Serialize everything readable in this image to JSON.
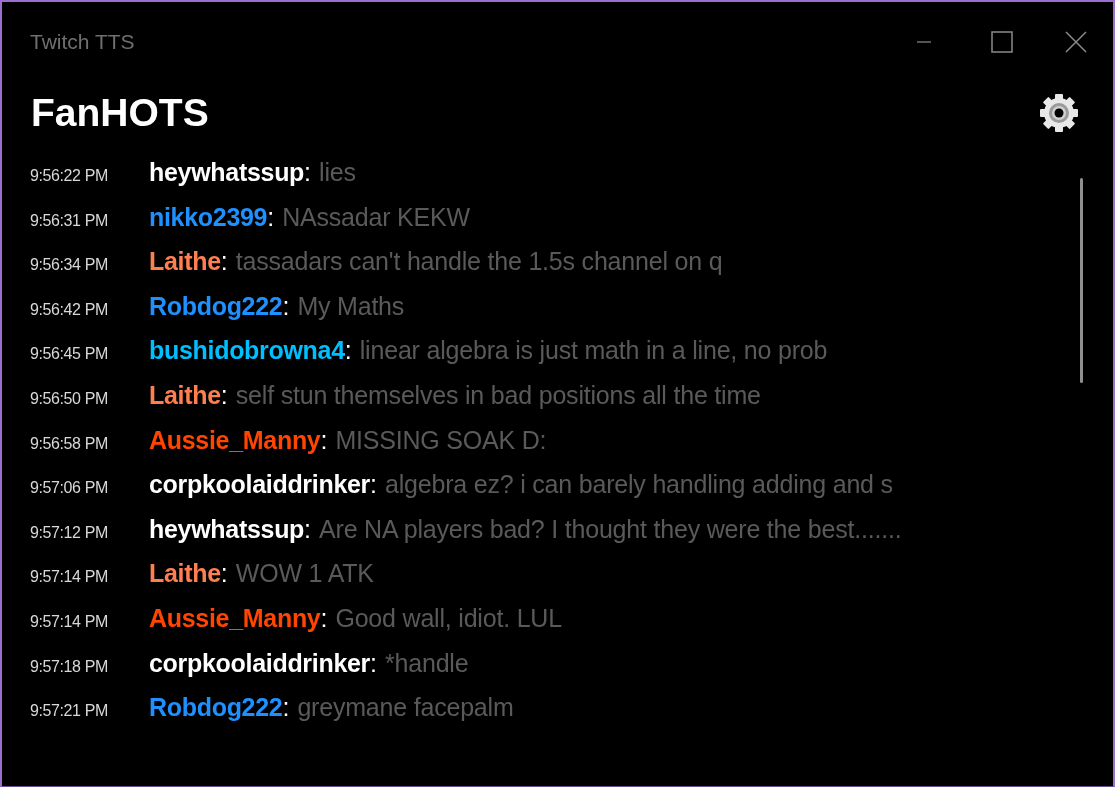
{
  "window": {
    "title": "Twitch TTS"
  },
  "header": {
    "title": "FanHOTS"
  },
  "messages": [
    {
      "time": "9:56:22 PM",
      "user": "heywhatssup",
      "color": "#ffffff",
      "text": "lies"
    },
    {
      "time": "9:56:31 PM",
      "user": "nikko2399",
      "color": "#1e90ff",
      "text": "NAssadar KEKW"
    },
    {
      "time": "9:56:34 PM",
      "user": "Laithe",
      "color": "#ff7f50",
      "text": "tassadars can't handle the 1.5s channel on q"
    },
    {
      "time": "9:56:42 PM",
      "user": "Robdog222",
      "color": "#1e90ff",
      "text": "My Maths"
    },
    {
      "time": "9:56:45 PM",
      "user": "bushidobrowna4",
      "color": "#00bfff",
      "text": "linear algebra is just math in a line, no prob"
    },
    {
      "time": "9:56:50 PM",
      "user": "Laithe",
      "color": "#ff7f50",
      "text": "self stun themselves in bad positions all the time"
    },
    {
      "time": "9:56:58 PM",
      "user": "Aussie_Manny",
      "color": "#ff4500",
      "text": "MISSING SOAK D:"
    },
    {
      "time": "9:57:06 PM",
      "user": "corpkoolaiddrinker",
      "color": "#ffffff",
      "text": "algebra ez? i can barely handling adding and s"
    },
    {
      "time": "9:57:12 PM",
      "user": "heywhatssup",
      "color": "#ffffff",
      "text": "Are NA players bad? I thought they were the best......."
    },
    {
      "time": "9:57:14 PM",
      "user": "Laithe",
      "color": "#ff7f50",
      "text": "WOW 1 ATK"
    },
    {
      "time": "9:57:14 PM",
      "user": "Aussie_Manny",
      "color": "#ff4500",
      "text": "Good wall, idiot. LUL"
    },
    {
      "time": "9:57:18 PM",
      "user": "corpkoolaiddrinker",
      "color": "#ffffff",
      "text": "*handle"
    },
    {
      "time": "9:57:21 PM",
      "user": "Robdog222",
      "color": "#1e90ff",
      "text": "greymane facepalm"
    }
  ],
  "separator": ":"
}
